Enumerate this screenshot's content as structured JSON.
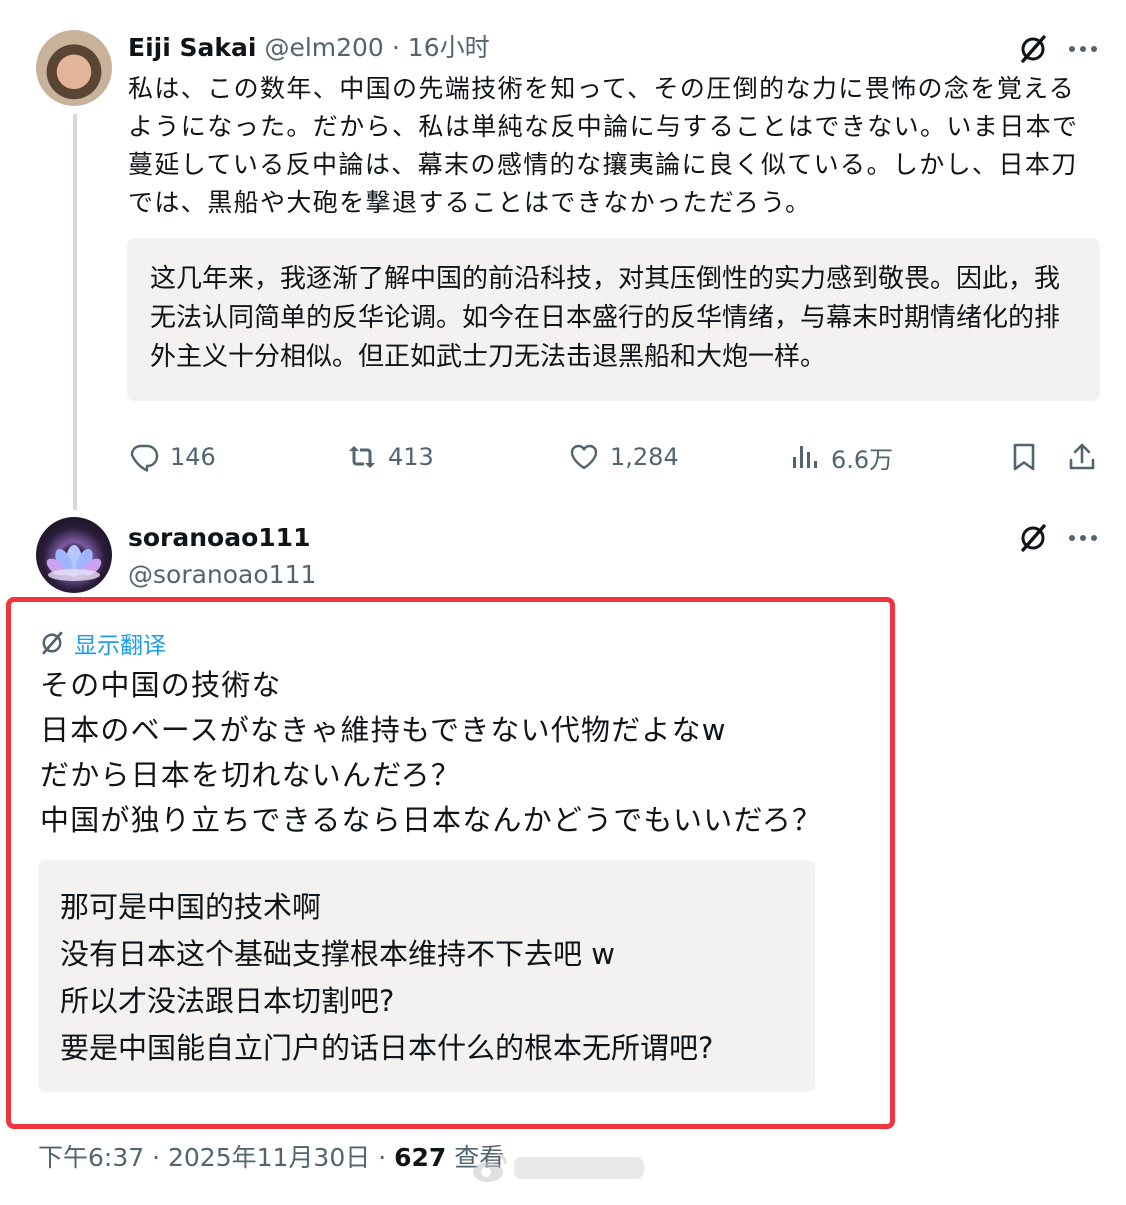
{
  "tweet1": {
    "author_name": "Eiji Sakai",
    "handle": "@elm200",
    "separator": "·",
    "time": "16小时",
    "body": "私は、この数年、中国の先端技術を知って、その圧倒的な力に畏怖の念を覚えるようになった。だから、私は単純な反中論に与することはできない。いま日本で蔓延している反中論は、幕末の感情的な攘夷論に良く似ている。しかし、日本刀では、黒船や大砲を撃退することはできなかっただろう。",
    "translation": "这几年来，我逐渐了解中国的前沿科技，对其压倒性的实力感到敬畏。因此，我无法认同简单的反华论调。如今在日本盛行的反华情绪，与幕末时期情绪化的排外主义十分相似。但正如武士刀无法击退黑船和大炮一样。",
    "actions": {
      "replies": "146",
      "reposts": "413",
      "likes": "1,284",
      "views": "6.6万"
    }
  },
  "tweet2": {
    "author_name": "soranoao111",
    "handle": "@soranoao111",
    "show_translation_label": "显示翻译",
    "body_lines": [
      "その中国の技術な",
      "日本のベースがなきゃ維持もできない代物だよなw",
      "だから日本を切れないんだろ？",
      "中国が独り立ちできるなら日本なんかどうでもいいだろ？"
    ],
    "translation_lines": [
      "那可是中国的技术啊",
      "没有日本这个基础支撑根本维持不下去吧 w",
      "所以才没法跟日本切割吧?",
      "要是中国能自立门户的话日本什么的根本无所谓吧?"
    ],
    "footer": {
      "time": "下午6:37",
      "separator": "·",
      "date": "2025年11月30日",
      "views_count": "627",
      "views_label": "查看"
    }
  },
  "colors": {
    "text_primary": "#0f1419",
    "text_secondary": "#536471",
    "link_blue": "#1d9bf0",
    "translation_bg": "#f4f2f0",
    "highlight_red": "#f1343e",
    "thread_line": "#cfd9de"
  }
}
